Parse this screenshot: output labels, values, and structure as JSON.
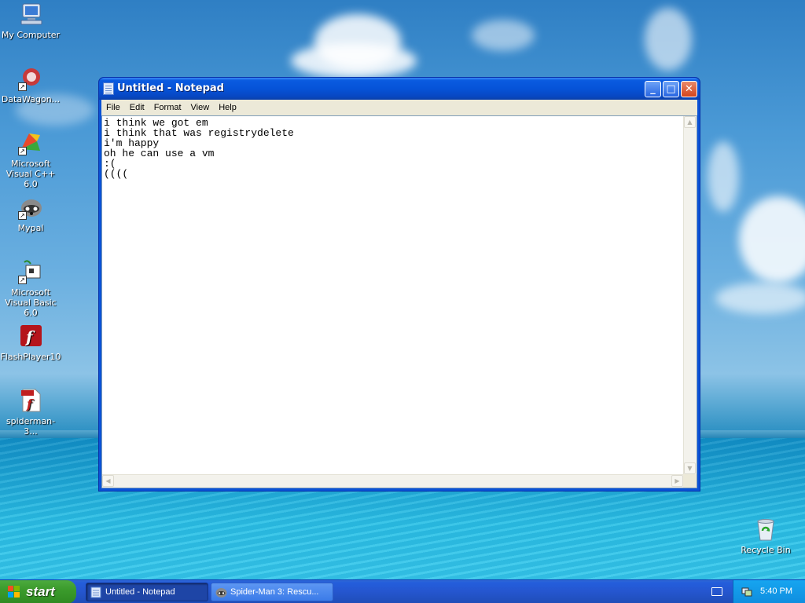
{
  "desktop": {
    "icons": [
      {
        "label": "My Computer",
        "icon": "my-computer-icon"
      },
      {
        "label": "DataWagon...",
        "icon": "datawagon-icon"
      },
      {
        "label": "Microsoft Visual C++ 6.0",
        "icon": "visual-cpp-icon"
      },
      {
        "label": "Mypal",
        "icon": "mypal-icon"
      },
      {
        "label": "Microsoft Visual Basic 6.0",
        "icon": "visual-basic-icon"
      },
      {
        "label": "FlashPlayer10",
        "icon": "flash-player-icon"
      },
      {
        "label": "spiderman-3...",
        "icon": "swf-file-icon"
      },
      {
        "label": "Recycle Bin",
        "icon": "recycle-bin-icon"
      }
    ]
  },
  "window": {
    "title": "Untitled - Notepad",
    "menu": [
      "File",
      "Edit",
      "Format",
      "View",
      "Help"
    ],
    "content": "i think we got em\ni think that was registrydelete\ni'm happy\noh he can use a vm\n:(\n(((("
  },
  "taskbar": {
    "start_label": "start",
    "tasks": [
      {
        "label": "Untitled - Notepad",
        "active": true,
        "icon": "notepad-icon"
      },
      {
        "label": "Spider-Man 3: Rescu...",
        "active": false,
        "icon": "mypal-icon"
      }
    ],
    "clock": "5:40 PM"
  },
  "colors": {
    "titlebar": "#0653d8",
    "start_button": "#3b9b2c",
    "taskbar": "#245edc",
    "close_button": "#d3441c"
  }
}
